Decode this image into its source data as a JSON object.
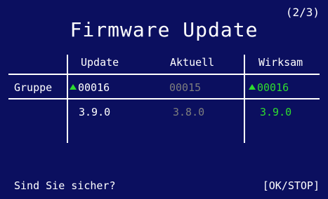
{
  "header": {
    "page_counter": "(2/3)",
    "title": "Firmware Update"
  },
  "table": {
    "columns": [
      "Update",
      "Aktuell",
      "Wirksam"
    ],
    "row_label": "Gruppe",
    "group": {
      "update": "00016",
      "current": "00015",
      "effective": "00016"
    },
    "version": {
      "update": "3.9.0",
      "current": "3.8.0",
      "effective": "3.9.0"
    }
  },
  "footer": {
    "prompt": "Sind Sie sicher?",
    "action": "[OK/STOP]"
  },
  "colors": {
    "background": "#0b0f5f",
    "text": "#ffffff",
    "effective": "#2edc2e",
    "current": "#7d7d7d"
  },
  "icons": {
    "update_marker": "triangle-up-icon",
    "effective_marker": "triangle-up-icon"
  }
}
